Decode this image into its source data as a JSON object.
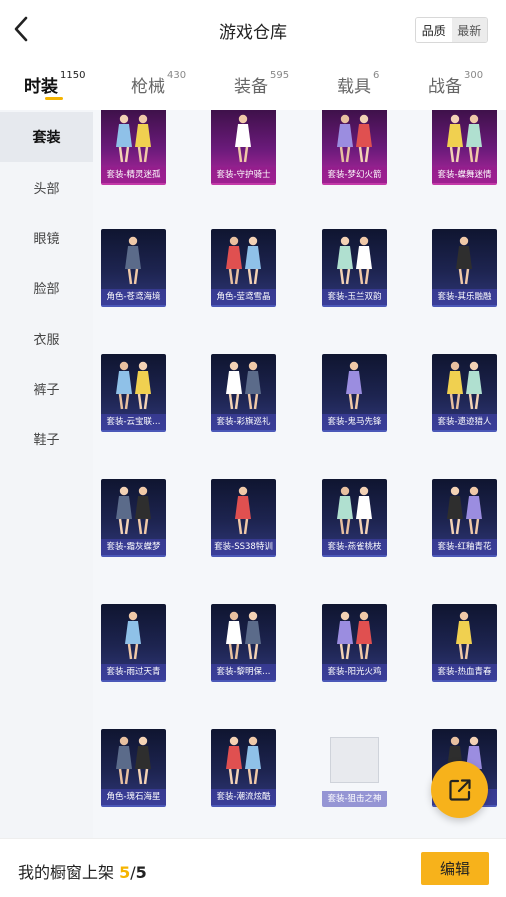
{
  "header": {
    "title": "游戏仓库",
    "sort_options": [
      "品质",
      "最新"
    ]
  },
  "tabs": [
    {
      "label": "时装",
      "count": "1150"
    },
    {
      "label": "枪械",
      "count": "430"
    },
    {
      "label": "装备",
      "count": "595"
    },
    {
      "label": "载具",
      "count": "6"
    },
    {
      "label": "战备",
      "count": "300"
    }
  ],
  "categories": [
    "套装",
    "头部",
    "眼镜",
    "脸部",
    "衣服",
    "裤子",
    "鞋子"
  ],
  "items": [
    {
      "label": "套装-精灵迷孤",
      "style": "purple"
    },
    {
      "label": "套装-守护骑士",
      "style": "purple"
    },
    {
      "label": "套装-梦幻火箭",
      "style": "purple"
    },
    {
      "label": "套装-蝶舞迷情",
      "style": "purple"
    },
    {
      "label": "角色-苍鸢海境",
      "style": "blue"
    },
    {
      "label": "角色-莹鸢雪晶",
      "style": "blue"
    },
    {
      "label": "套装-玉兰双韵",
      "style": "blue"
    },
    {
      "label": "套装-其乐融融",
      "style": "blue"
    },
    {
      "label": "套装-云宝联…",
      "style": "blue"
    },
    {
      "label": "套装-彩旗巡礼",
      "style": "blue"
    },
    {
      "label": "套装-鬼马先锋",
      "style": "blue"
    },
    {
      "label": "套装-遗迹猎人",
      "style": "blue"
    },
    {
      "label": "套装-霜灰蝶梦",
      "style": "blue"
    },
    {
      "label": "套装-SS38特训",
      "style": "blue"
    },
    {
      "label": "套装-燕雀桃枝",
      "style": "blue"
    },
    {
      "label": "套装-红釉青花",
      "style": "blue"
    },
    {
      "label": "套装-雨过天青",
      "style": "blue"
    },
    {
      "label": "套装-黎明保…",
      "style": "blue"
    },
    {
      "label": "套装-阳光火鸡",
      "style": "blue"
    },
    {
      "label": "套装-热血青春",
      "style": "blue"
    },
    {
      "label": "角色-瑰石海星",
      "style": "blue"
    },
    {
      "label": "套装-潮流炫酷",
      "style": "blue"
    },
    {
      "label": "套装-狙击之神",
      "style": "blank"
    },
    {
      "label": "",
      "style": "blue"
    }
  ],
  "bottom": {
    "shelf_label": "我的橱窗上架",
    "shelf_current": "5",
    "shelf_max": "5",
    "edit_label": "编辑"
  },
  "colors": {
    "accent": "#f7b21b",
    "card_purple": "#b5289e",
    "card_blue": "#2e3677"
  }
}
